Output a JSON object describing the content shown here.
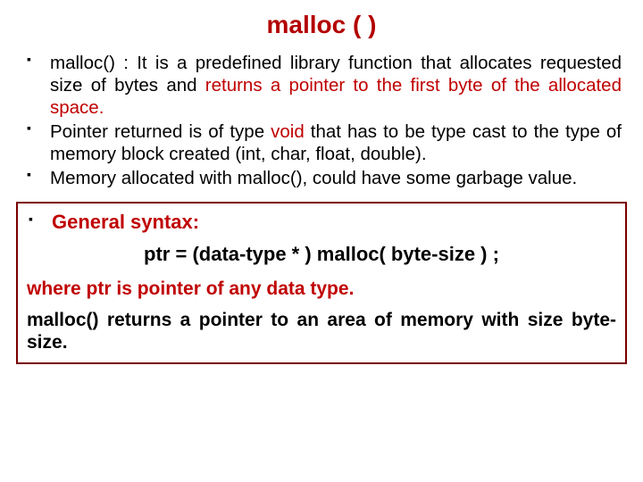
{
  "title": "malloc ( )",
  "bullets": {
    "b1_pre": "malloc() : It is a predefined library function that allocates requested size of bytes and ",
    "b1_red": "returns a pointer to the first byte of the allocated space.",
    "b2_pre": "Pointer returned is of type ",
    "b2_red": "void",
    "b2_post": " that has to be type cast to the type of memory block created (int, char, float, double).",
    "b3": "Memory allocated with malloc(), could have some garbage value."
  },
  "box": {
    "heading": "General syntax:",
    "syntax": "ptr = (data-type * ) malloc( byte-size ) ;",
    "where": "where ptr is pointer of any data type.",
    "returns": "malloc() returns a pointer to an area of memory with size byte-size."
  }
}
